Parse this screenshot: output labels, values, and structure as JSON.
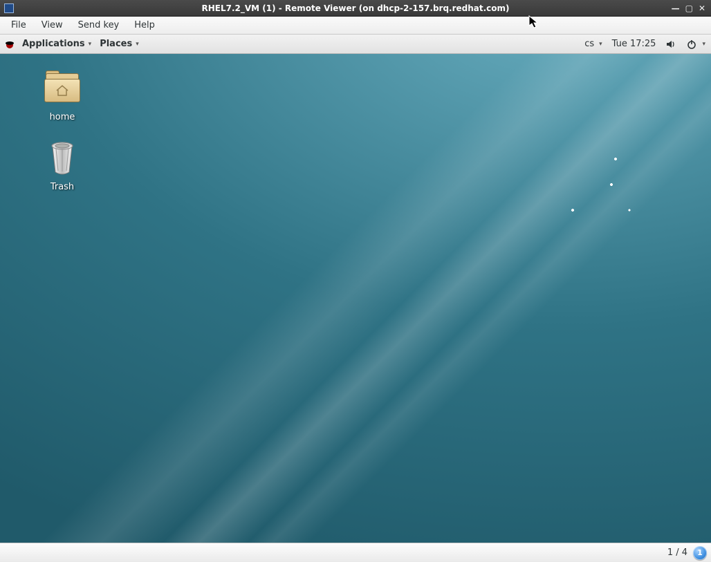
{
  "window": {
    "title": "RHEL7.2_VM (1) - Remote Viewer (on dhcp-2-157.brq.redhat.com)"
  },
  "viewer_menu": {
    "items": [
      "File",
      "View",
      "Send key",
      "Help"
    ]
  },
  "panel": {
    "applications": "Applications",
    "places": "Places",
    "input_source": "cs",
    "clock": "Tue 17:25"
  },
  "desktop": {
    "icons": [
      {
        "name": "home"
      },
      {
        "name": "Trash"
      }
    ]
  },
  "statusbar": {
    "workspace_text": "1 / 4",
    "workspace_current": "1"
  }
}
